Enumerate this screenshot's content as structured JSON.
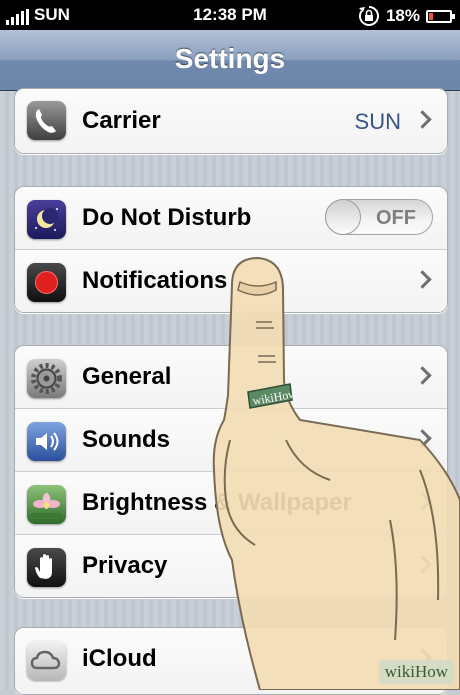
{
  "status_bar": {
    "carrier": "SUN",
    "time": "12:38 PM",
    "battery": "18%",
    "battery_level": 0.18
  },
  "navbar": {
    "title": "Settings"
  },
  "groups": [
    {
      "items": [
        {
          "label": "Carrier",
          "value": "SUN",
          "icon": "phone-icon"
        }
      ]
    },
    {
      "items": [
        {
          "label": "Do Not Disturb",
          "icon": "moon-icon",
          "toggle": "OFF"
        },
        {
          "label": "Notifications",
          "icon": "notifications-icon"
        }
      ]
    },
    {
      "items": [
        {
          "label": "General",
          "icon": "gear-icon"
        },
        {
          "label": "Sounds",
          "icon": "speaker-icon"
        },
        {
          "label": "Brightness & Wallpaper",
          "icon": "flower-icon"
        },
        {
          "label": "Privacy",
          "icon": "hand-icon"
        }
      ]
    },
    {
      "items": [
        {
          "label": "iCloud",
          "icon": "cloud-icon"
        }
      ]
    }
  ],
  "overlay": {
    "ring_text": "wikiHow",
    "watermark": "wikiHow"
  }
}
